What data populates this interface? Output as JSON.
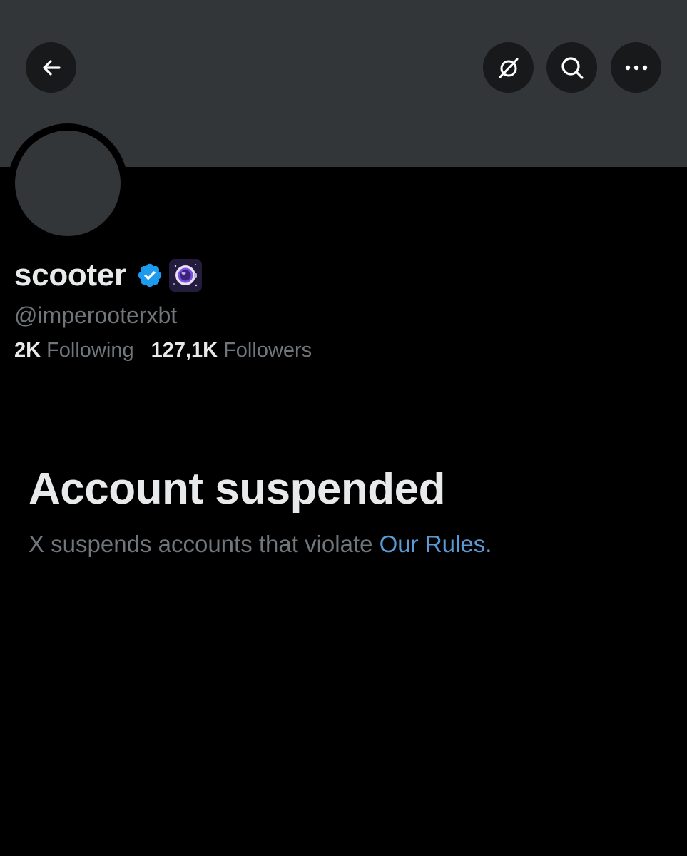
{
  "header": {
    "back_icon": "arrow-left-icon",
    "grok_icon": "grok-slash-circle-icon",
    "search_icon": "search-icon",
    "more_icon": "more-horizontal-icon",
    "banner_color": "#333639",
    "button_color": "#17191b"
  },
  "profile": {
    "display_name": "scooter",
    "verified_icon": "verified-badge-icon",
    "verified_color": "#1d9bf0",
    "affiliate_icon": "astronaut-badge-icon",
    "handle": "@imperooterxbt",
    "following_count": "2K",
    "following_label": "Following",
    "followers_count": "127,1K",
    "followers_label": "Followers"
  },
  "suspension": {
    "title": "Account suspended",
    "message": "X suspends accounts that violate",
    "link_text": "Our Rules",
    "trailing": ".",
    "link_color": "#5b9bd5"
  }
}
